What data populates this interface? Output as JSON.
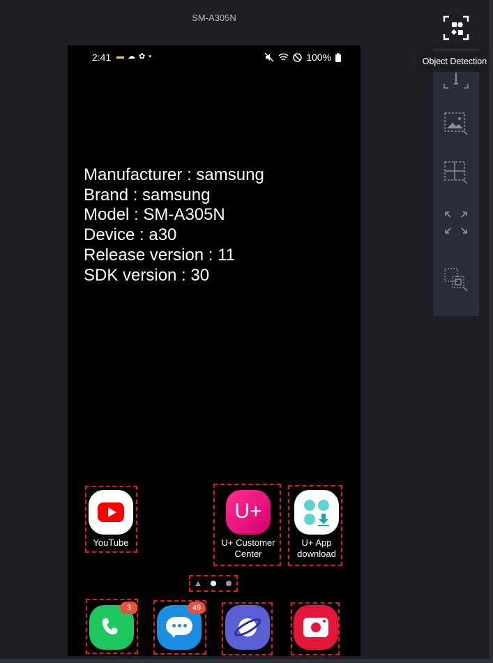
{
  "device": {
    "title": "SM-A305N"
  },
  "status_bar": {
    "time": "2:41",
    "battery": "100%"
  },
  "info_lines": [
    "Manufacturer : samsung",
    "Brand : samsung",
    "Model : SM-A305N",
    "Device : a30",
    "Release version : 11",
    "SDK version : 30"
  ],
  "apps": {
    "youtube": {
      "label": "YouTube"
    },
    "uplus_customer": {
      "label_line1": "U+ Customer",
      "label_line2": "Center",
      "icon_text": "U+"
    },
    "uplus_app": {
      "label_line1": "U+ App",
      "label_line2": "download"
    }
  },
  "dock": {
    "phone": {
      "badge": "3"
    },
    "messages": {
      "badge": "49"
    },
    "internet": {},
    "camera": {}
  },
  "toolbar": {
    "tooltip": "Object Detection"
  },
  "colors": {
    "detection_box": "#e01b24",
    "youtube_red": "#ff0000",
    "uplus_pink": "#e6007e",
    "phone_green": "#1fc55e",
    "messages_blue": "#1a8ee0",
    "internet_purple": "#5b5fd6",
    "camera_red": "#e4163a",
    "badge_orange": "#e5533d"
  }
}
